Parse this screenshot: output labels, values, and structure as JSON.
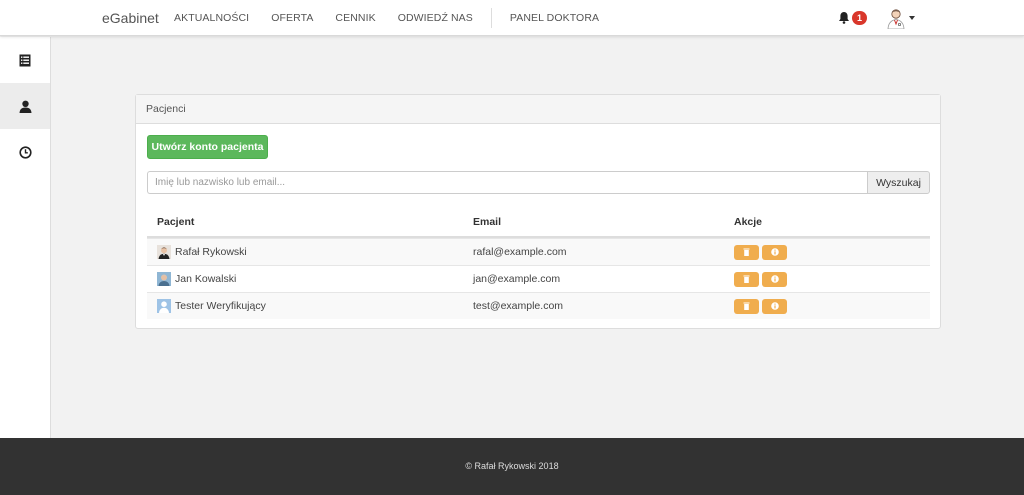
{
  "navbar": {
    "brand": "eGabinet",
    "links": [
      "AKTUALNOŚCI",
      "OFERTA",
      "CENNIK",
      "ODWIEDŹ NAS"
    ],
    "doctor_panel": "PANEL DOKTORA",
    "notification_count": "1"
  },
  "sidebar": {
    "items": [
      {
        "icon": "list-icon",
        "active": false
      },
      {
        "icon": "user-icon",
        "active": true
      },
      {
        "icon": "clock-icon",
        "active": false
      }
    ]
  },
  "panel": {
    "title": "Pacjenci",
    "create_button": "Utwórz konto pacjenta",
    "search_placeholder": "Imię lub nazwisko lub email...",
    "search_button": "Wyszukaj",
    "columns": [
      "Pacjent",
      "Email",
      "Akcje"
    ],
    "rows": [
      {
        "name": "Rafał Rykowski",
        "email": "rafal@example.com",
        "avatar": "photo-man"
      },
      {
        "name": "Jan Kowalski",
        "email": "jan@example.com",
        "avatar": "photo-older-man"
      },
      {
        "name": "Tester Weryfikujący",
        "email": "test@example.com",
        "avatar": "default-user"
      }
    ],
    "action_icons": [
      "trash-icon",
      "info-icon"
    ]
  },
  "footer": {
    "text": "© Rafał Rykowski 2018"
  },
  "colors": {
    "accent_green": "#5cb85c",
    "action_orange": "#f0ad4e",
    "badge_red": "#d9372b",
    "footer_bg": "#323232"
  }
}
